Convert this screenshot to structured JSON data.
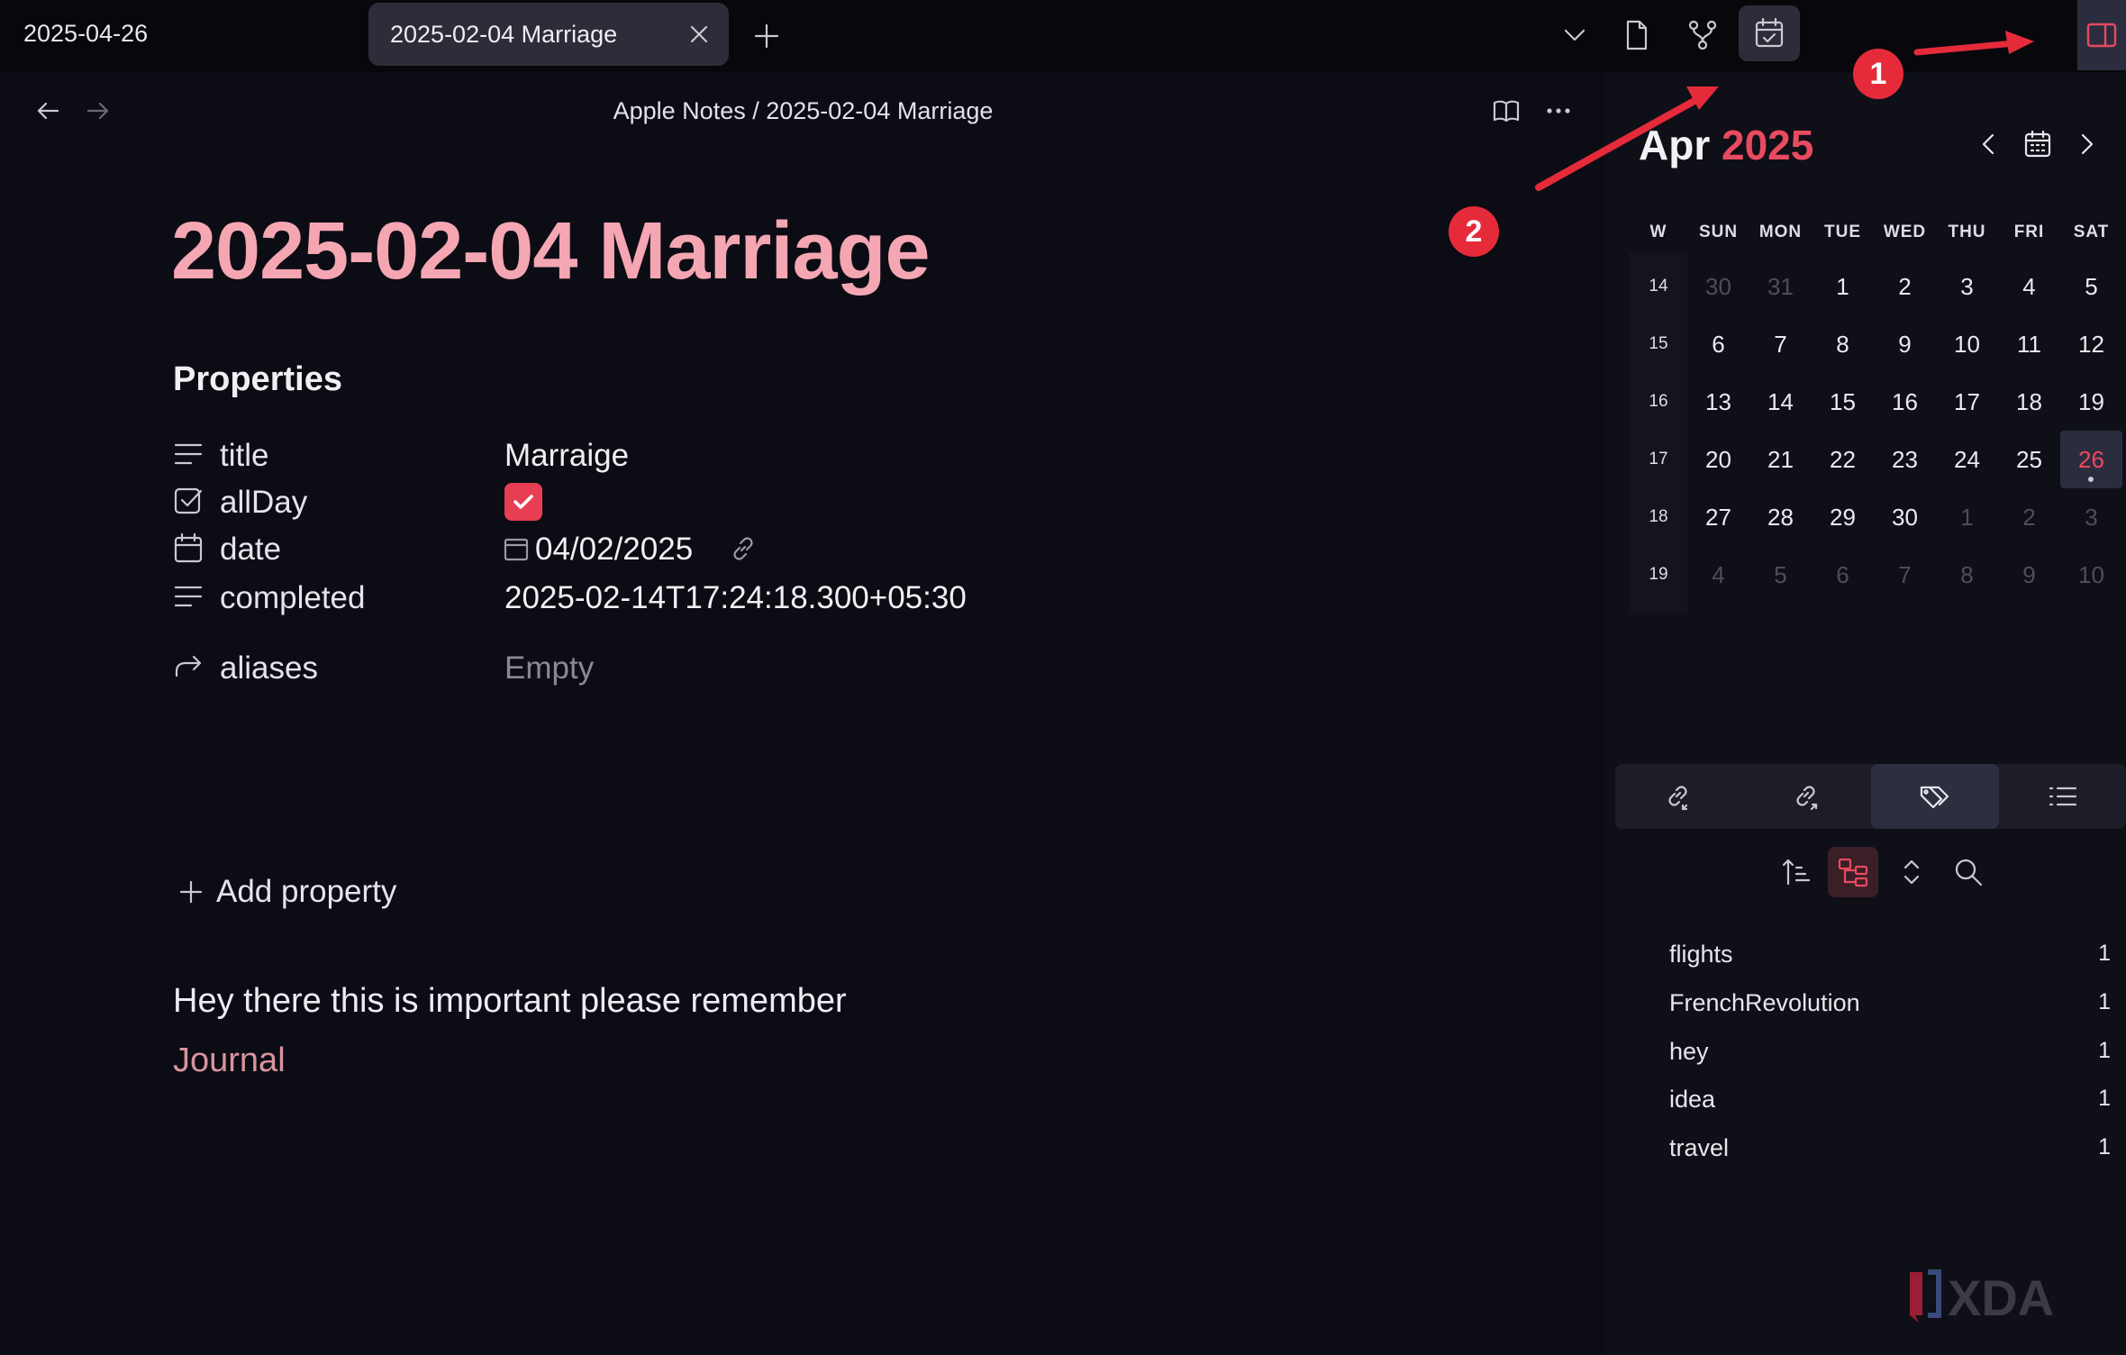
{
  "topbar": {
    "date": "2025-04-26",
    "tab_title": "2025-02-04 Marriage"
  },
  "main": {
    "breadcrumb": "Apple Notes / 2025-02-04 Marriage",
    "title": "2025-02-04 Marriage",
    "properties_heading": "Properties",
    "properties": [
      {
        "key": "title",
        "value": "Marraige",
        "icon": "text-lines-icon"
      },
      {
        "key": "allDay",
        "value": "",
        "icon": "checkbox-icon",
        "checked": true
      },
      {
        "key": "date",
        "value": "04/02/2025",
        "icon": "calendar-icon"
      },
      {
        "key": "completed",
        "value": "2025-02-14T17:24:18.300+05:30",
        "icon": "text-lines-icon"
      },
      {
        "key": "aliases",
        "value": "Empty",
        "icon": "forward-arrow-icon"
      }
    ],
    "add_property": "Add property",
    "body_text": "Hey there this is important please remember",
    "tag_text": "Journal"
  },
  "calendar": {
    "month": "Apr",
    "year": "2025",
    "headers": [
      "W",
      "SUN",
      "MON",
      "TUE",
      "WED",
      "THU",
      "FRI",
      "SAT"
    ],
    "weeks": [
      {
        "week": "14",
        "days": [
          "30",
          "31",
          "1",
          "2",
          "3",
          "4",
          "5"
        ],
        "dim": [
          true,
          true,
          false,
          false,
          false,
          false,
          false
        ]
      },
      {
        "week": "15",
        "days": [
          "6",
          "7",
          "8",
          "9",
          "10",
          "11",
          "12"
        ],
        "dim": [
          false,
          false,
          false,
          false,
          false,
          false,
          false
        ]
      },
      {
        "week": "16",
        "days": [
          "13",
          "14",
          "15",
          "16",
          "17",
          "18",
          "19"
        ],
        "dim": [
          false,
          false,
          false,
          false,
          false,
          false,
          false
        ]
      },
      {
        "week": "17",
        "days": [
          "20",
          "21",
          "22",
          "23",
          "24",
          "25",
          "26"
        ],
        "dim": [
          false,
          false,
          false,
          false,
          false,
          false,
          false
        ]
      },
      {
        "week": "18",
        "days": [
          "27",
          "28",
          "29",
          "30",
          "1",
          "2",
          "3"
        ],
        "dim": [
          false,
          false,
          false,
          false,
          true,
          true,
          true
        ]
      },
      {
        "week": "19",
        "days": [
          "4",
          "5",
          "6",
          "7",
          "8",
          "9",
          "10"
        ],
        "dim": [
          true,
          true,
          true,
          true,
          true,
          true,
          true
        ]
      }
    ],
    "today": "26",
    "accent": "#e84a5f"
  },
  "sidebar_tabs": [
    "backlinks-icon",
    "outgoing-links-icon",
    "tags-icon",
    "outline-icon"
  ],
  "tag_tools": [
    "sort-icon",
    "tree-view-icon",
    "expand-collapse-icon",
    "search-icon"
  ],
  "tags": [
    {
      "name": "flights",
      "count": "1"
    },
    {
      "name": "FrenchRevolution",
      "count": "1"
    },
    {
      "name": "hey",
      "count": "1"
    },
    {
      "name": "idea",
      "count": "1"
    },
    {
      "name": "travel",
      "count": "1"
    }
  ],
  "annotations": {
    "badge_1": "1",
    "badge_2": "2"
  },
  "watermark": "XDA"
}
